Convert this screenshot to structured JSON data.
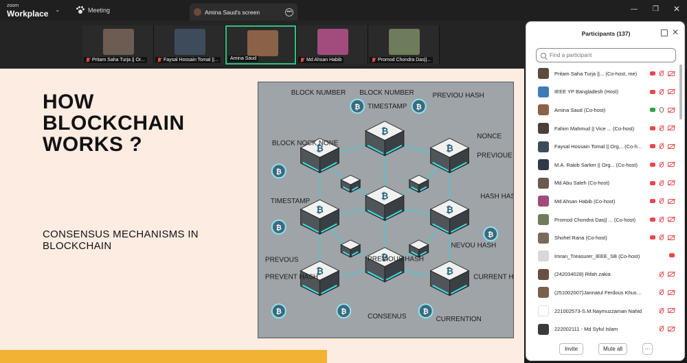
{
  "app": {
    "brand_top": "zoom",
    "brand_bottom": "Workplace",
    "meeting_label": "Meeting"
  },
  "share_tab": {
    "label": "Amina Saud's screen"
  },
  "video_tiles": [
    {
      "name": "Pritam Saha Turja || Or...",
      "muted": true,
      "color": "#6d5c52"
    },
    {
      "name": "Faysal Hossain Tomal ||...",
      "muted": true,
      "color": "#3e4b5a"
    },
    {
      "name": "Amina Saud",
      "muted": false,
      "active": true,
      "color": "#8a6248"
    },
    {
      "name": "Md Ahsan Habib",
      "muted": true,
      "color": "#a24c7d"
    },
    {
      "name": "Promod Chondra Das||...",
      "muted": true,
      "color": "#6e7c5b"
    }
  ],
  "slide": {
    "title": "HOW\nBLOCKCHAIN\nWORKS ?",
    "subtitle": "CONSENSUS MECHANISMS IN\nBLOCKCHAIN",
    "art_labels": [
      "BLOCK NUMBER",
      "BLOCK NUMBER",
      "PREVIOU HASH",
      "TIMESTAMP",
      "NONCE",
      "PREVIOUE HASH",
      "BLOCK NOCK NONE",
      "TIMESTAMP",
      "HASH HASH",
      "PREVOUS",
      "NEVOU HASH",
      "PREVENT HASH",
      "CURRENT HASH",
      "CONSENUS",
      "CURRENTION",
      "PREVIOUS HASH"
    ]
  },
  "participants": {
    "title": "Participants (137)",
    "search_placeholder": "Find a participant",
    "list": [
      {
        "name": "Pritam Saha Turja ||... (Co-host, me)",
        "avatar": "#5a4a40",
        "icons": [
          "cam",
          "mic",
          "vid"
        ]
      },
      {
        "name": "IEEE YP Bangladesh (Host)",
        "avatar": "#3f7bb5",
        "icons": [
          "cam",
          "mic",
          "vid"
        ]
      },
      {
        "name": "Amina Saud (Co-host)",
        "avatar": "#8a6248",
        "icons": [
          "share",
          "mic-on",
          "vid"
        ]
      },
      {
        "name": "Fahim Mahmud  || Vice ... (Co-host)",
        "avatar": "#4b3f38",
        "icons": [
          "cam",
          "mic",
          "vid"
        ]
      },
      {
        "name": "Faysal Hossain Tomal || Org... (Co-host)",
        "avatar": "#3e4b5a",
        "icons": [
          "cam",
          "mic",
          "vid"
        ]
      },
      {
        "name": "M.A. Rakib Sarker || Org... (Co-host)",
        "avatar": "#2f3a44",
        "icons": [
          "cam",
          "mic",
          "vid"
        ]
      },
      {
        "name": "Md Abu Saleh (Co-host)",
        "avatar": "#6a5a50",
        "icons": [
          "cam",
          "mic",
          "vid"
        ]
      },
      {
        "name": "Md Ahsan Habib (Co-host)",
        "avatar": "#a24c7d",
        "icons": [
          "cam",
          "mic",
          "vid"
        ]
      },
      {
        "name": "Promod Chondra Das|| ... (Co-host)",
        "avatar": "#6e7c5b",
        "icons": [
          "cam",
          "mic",
          "vid"
        ]
      },
      {
        "name": "Shohel Rana (Co-host)",
        "avatar": "#7a6a5e",
        "icons": [
          "cam",
          "mic",
          "vid"
        ]
      },
      {
        "name": "Imran_Treasurer_IEEE_SB (Co-host)",
        "avatar": "#d8d8d8",
        "icons": [
          "cam"
        ]
      },
      {
        "name": "(242034028) Rifah zakia",
        "avatar": "#6b4f44",
        "icons": [
          "mic",
          "vid"
        ]
      },
      {
        "name": "(251002007)Jannatul Ferdous Khushbu",
        "avatar": "#7b5d4c",
        "icons": [
          "mic",
          "vid"
        ]
      },
      {
        "name": "221002573-S.M.Naymuzzaman Nahid",
        "avatar": "#ffffff",
        "icons": [
          "mic",
          "vid"
        ]
      },
      {
        "name": "222002111 - Md Syful Islam",
        "avatar": "#3a3a3a",
        "icons": [
          "mic",
          "vid"
        ]
      }
    ],
    "invite_label": "Invite",
    "mute_all_label": "Mute all",
    "more_label": "···"
  },
  "colors": {
    "accent_green": "#2ec27e",
    "slide_bg": "#fcece2",
    "slide_bar": "#f2b233",
    "muted_red": "#e5484d"
  }
}
